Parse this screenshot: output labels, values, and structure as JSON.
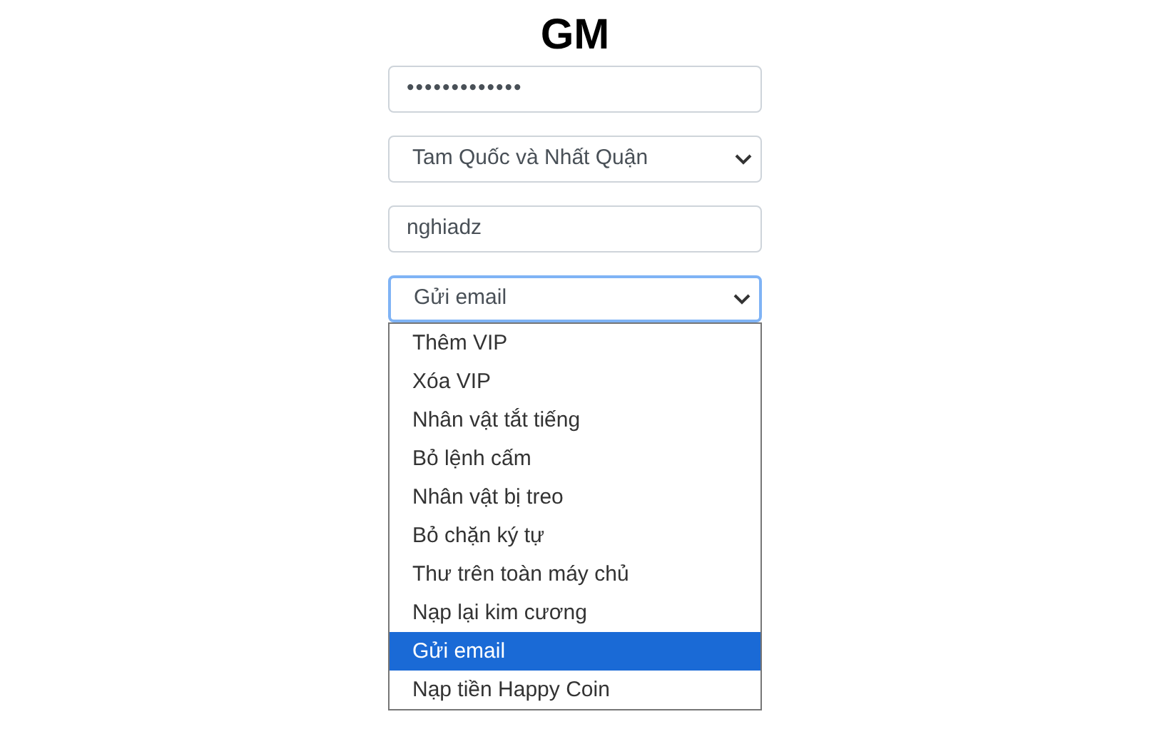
{
  "title": "GM",
  "password": {
    "value": "•••••••••••••"
  },
  "server_select": {
    "value": "Tam Quốc và Nhất Quận"
  },
  "username": {
    "value": "nghiadz"
  },
  "action_select": {
    "value": "Gửi email",
    "expanded": true,
    "options": [
      {
        "label": "Thêm VIP",
        "selected": false
      },
      {
        "label": "Xóa VIP",
        "selected": false
      },
      {
        "label": "Nhân vật tắt tiếng",
        "selected": false
      },
      {
        "label": "Bỏ lệnh cấm",
        "selected": false
      },
      {
        "label": "Nhân vật bị treo",
        "selected": false
      },
      {
        "label": "Bỏ chặn ký tự",
        "selected": false
      },
      {
        "label": "Thư trên toàn máy chủ",
        "selected": false
      },
      {
        "label": "Nạp lại kim cương",
        "selected": false
      },
      {
        "label": "Gửi email",
        "selected": true
      },
      {
        "label": "Nạp tiền Happy Coin",
        "selected": false
      }
    ]
  }
}
